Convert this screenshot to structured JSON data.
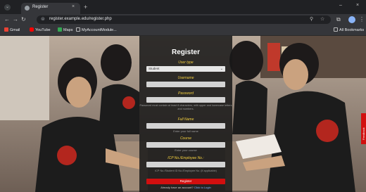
{
  "browser": {
    "tab_title": "Register",
    "tab_close": "×",
    "new_tab": "+",
    "window_controls": [
      "–",
      "×"
    ],
    "url": "register.example.edu/register.php",
    "bookmarks": [
      "Gmail",
      "YouTube",
      "Maps",
      "MyAccountModule..."
    ],
    "all_bookmarks": "All Bookmarks"
  },
  "form": {
    "heading": "Register",
    "user_type_label": "User type",
    "user_type_value": "Student",
    "username_label": "Username",
    "password_label": "Password",
    "password_hint": "Password must contain at least 8 characters, with upper and lowercase letters and numbers.",
    "fullname_label": "Full Name",
    "fullname_placeholder": "Enter your full name",
    "course_label": "Course",
    "course_placeholder": "Enter your course",
    "id_label": "ICP No./Employee No.:",
    "id_hint": "ICP No./Student ID No./Employee No. (if applicable)",
    "register_button": "Register",
    "login_prompt": "Already have an account?",
    "login_link": "Click to Login"
  },
  "feedback_tab": "Feedback",
  "colors": {
    "accent_red": "#d20f0f",
    "label_yellow": "#f4d03f",
    "panel_bg": "#191919"
  }
}
